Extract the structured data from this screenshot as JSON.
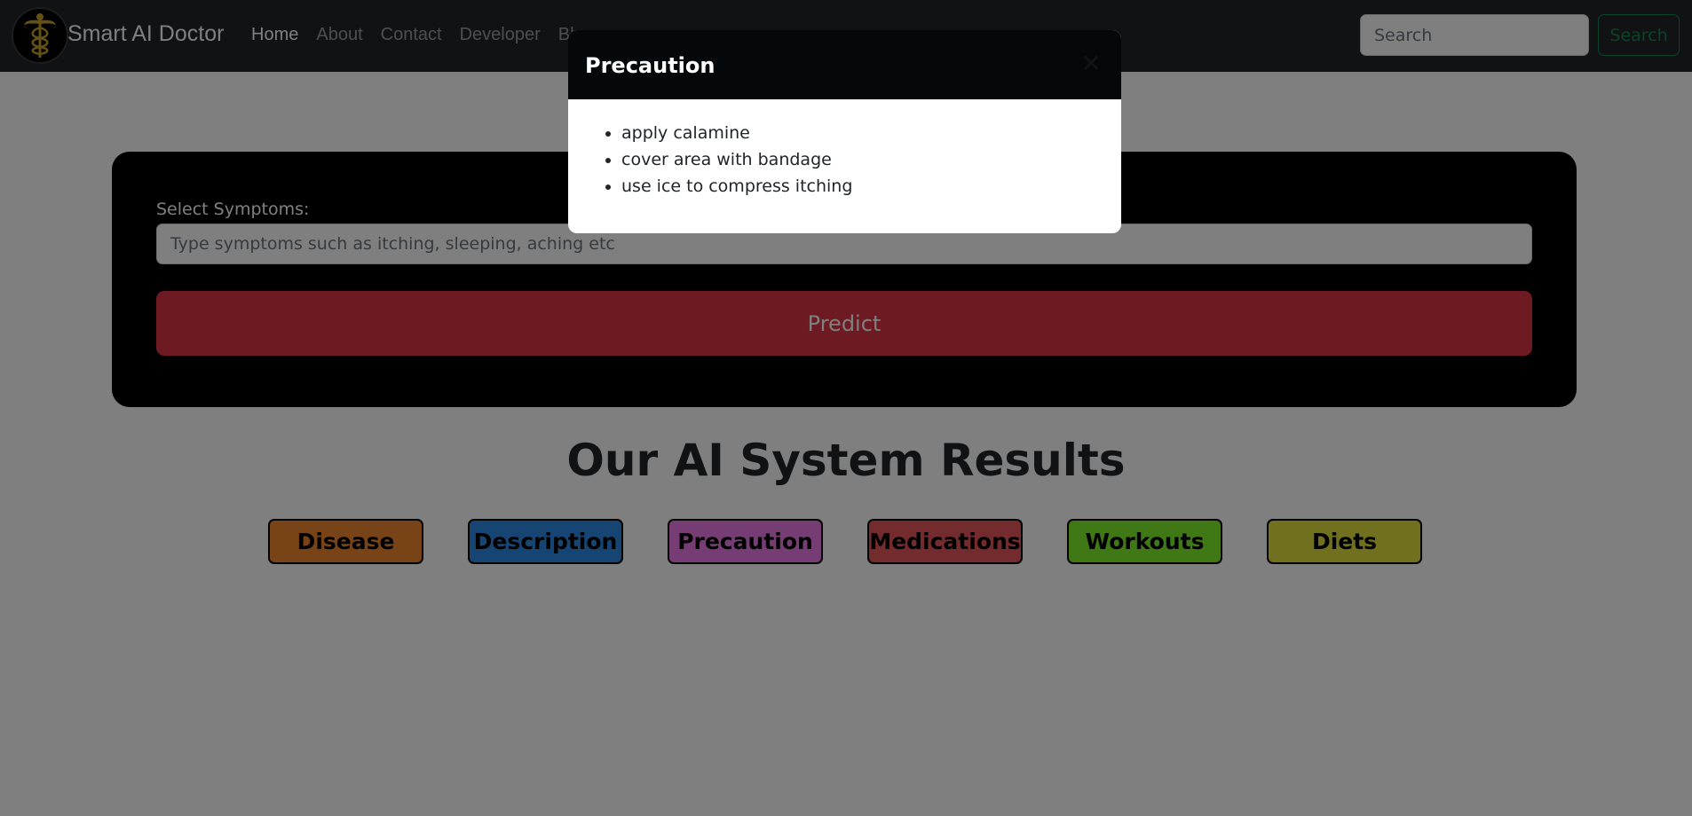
{
  "navbar": {
    "brand": "Smart AI Doctor",
    "links": [
      "Home",
      "About",
      "Contact",
      "Developer",
      "Blog"
    ],
    "active": "Home",
    "search_placeholder": "Search",
    "search_button": "Search",
    "logo_icon": "caduceus-icon"
  },
  "form": {
    "label": "Select Symptoms:",
    "placeholder": "Type symptoms such as itching, sleeping, aching etc",
    "predict_button": "Predict"
  },
  "results": {
    "title": "Our AI System Results",
    "buttons": [
      {
        "label": "Disease",
        "color": "#f0882e"
      },
      {
        "label": "Description",
        "color": "#2d8ae8"
      },
      {
        "label": "Precaution",
        "color": "#ec7be8"
      },
      {
        "label": "Medications",
        "color": "#e6565c"
      },
      {
        "label": "Workouts",
        "color": "#82f02d"
      },
      {
        "label": "Diets",
        "color": "#e1e03d"
      }
    ]
  },
  "modal": {
    "title": "Precaution",
    "close_icon": "close-icon",
    "items": [
      "apply calamine",
      "cover area with bandage",
      "use ice to compress itching"
    ]
  }
}
